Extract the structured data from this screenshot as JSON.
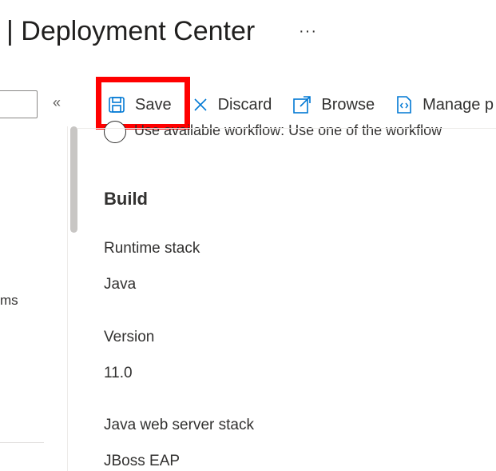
{
  "header": {
    "title": "| Deployment Center",
    "more_label": "···"
  },
  "sidebar": {
    "collapse_label": "«",
    "fragment_text": "ms"
  },
  "toolbar": {
    "save_label": "Save",
    "discard_label": "Discard",
    "browse_label": "Browse",
    "manage_label": "Manage p"
  },
  "content": {
    "workflow_option": "Use available workflow: Use one of the workflow",
    "build_title": "Build",
    "runtime_stack_label": "Runtime stack",
    "runtime_stack_value": "Java",
    "version_label": "Version",
    "version_value": "11.0",
    "server_stack_label": "Java web server stack",
    "server_stack_value": "JBoss EAP"
  },
  "colors": {
    "highlight": "#ff0000",
    "icon_blue": "#0078d4"
  }
}
